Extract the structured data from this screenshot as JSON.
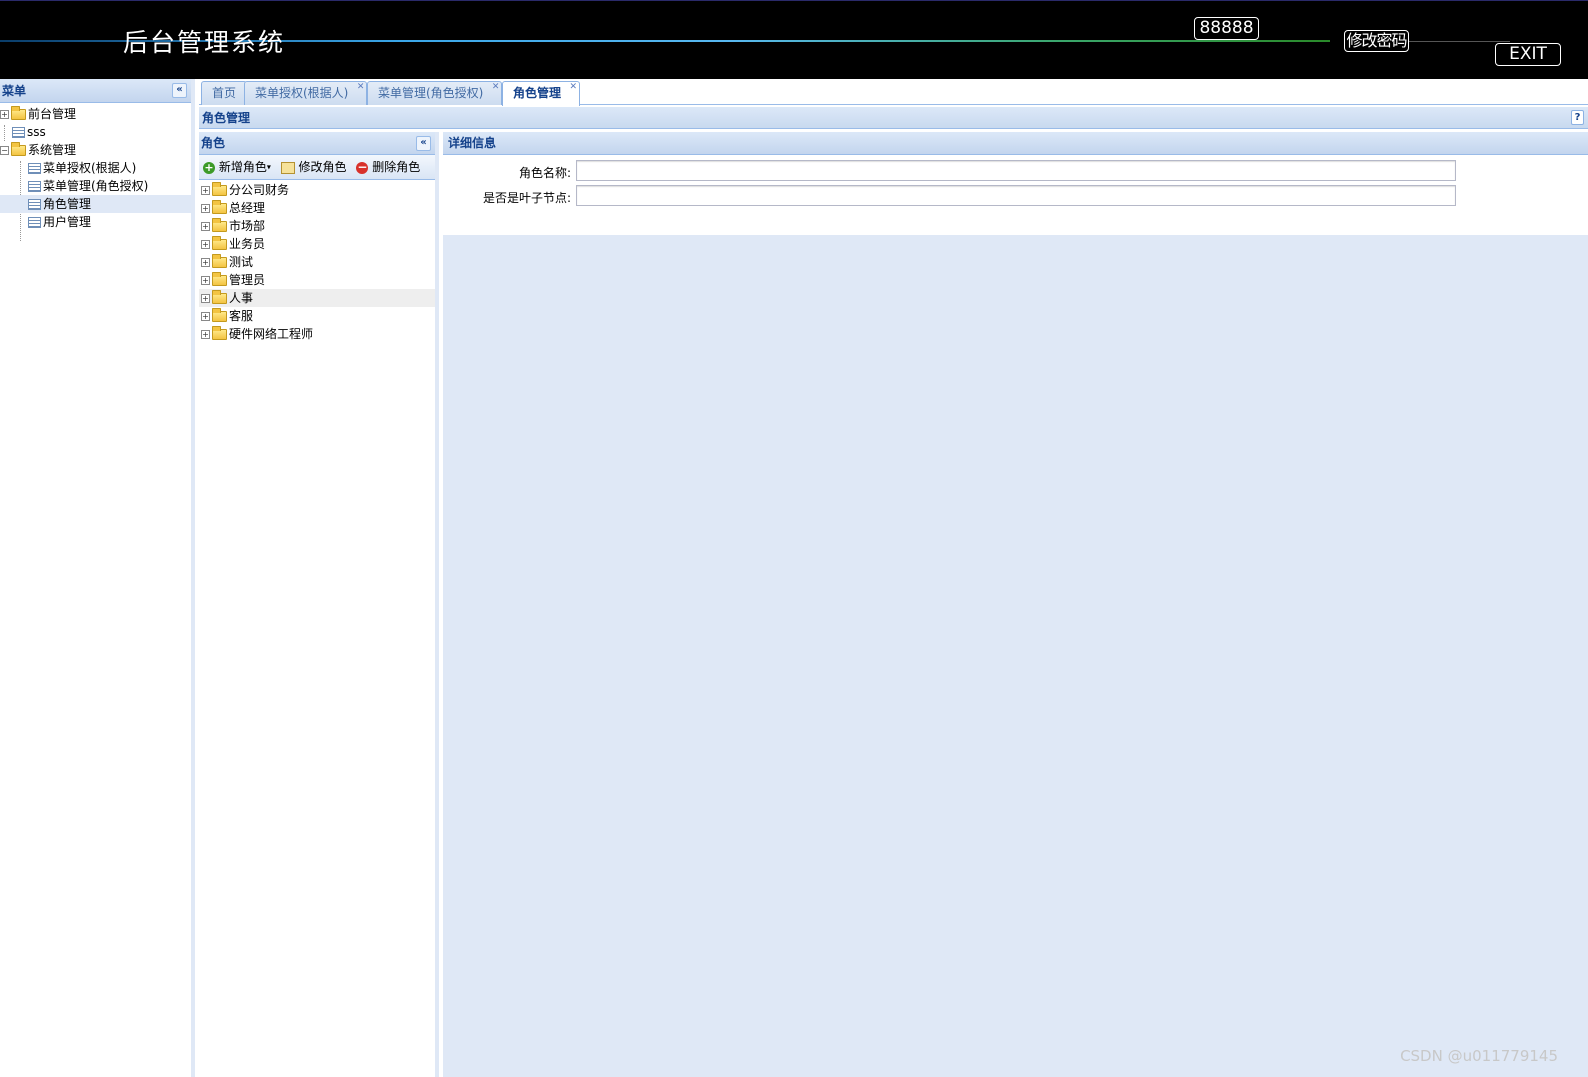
{
  "header": {
    "title": "后台管理系统",
    "user_button": "88888",
    "change_password_button": "修改密码",
    "exit_button": "EXIT"
  },
  "left_menu": {
    "title": "菜单",
    "collapse_icon": "double-chevron-left-icon",
    "items": [
      {
        "label": "前台管理",
        "type": "folder",
        "expanded": false
      },
      {
        "label": "sss",
        "type": "leaf"
      },
      {
        "label": "系统管理",
        "type": "folder",
        "expanded": true
      },
      {
        "label": "菜单授权(根据人)",
        "type": "leaf"
      },
      {
        "label": "菜单管理(角色授权)",
        "type": "leaf"
      },
      {
        "label": "角色管理",
        "type": "leaf",
        "selected": true
      },
      {
        "label": "用户管理",
        "type": "leaf"
      }
    ]
  },
  "tabs": [
    {
      "label": "首页",
      "closable": false
    },
    {
      "label": "菜单授权(根据人)",
      "closable": true
    },
    {
      "label": "菜单管理(角色授权)",
      "closable": true
    },
    {
      "label": "角色管理",
      "closable": true,
      "active": true
    }
  ],
  "content": {
    "title": "角色管理",
    "help_icon": "?"
  },
  "roles_panel": {
    "title": "角色",
    "toolbar": {
      "add": "新增角色",
      "edit": "修改角色",
      "delete": "删除角色"
    },
    "roles": [
      "分公司财务",
      "总经理",
      "市场部",
      "业务员",
      "测试",
      "管理员",
      "人事",
      "客服",
      "硬件网络工程师"
    ]
  },
  "detail_panel": {
    "title": "详细信息",
    "fields": [
      {
        "label": "角色名称:",
        "value": ""
      },
      {
        "label": "是否是叶子节点:",
        "value": ""
      }
    ]
  },
  "watermark": "CSDN @u011779145",
  "colors": {
    "header_bg": "#000000",
    "panel_header_text": "#15428b",
    "panel_bg": "#dfe8f6",
    "border": "#99bbe8"
  }
}
